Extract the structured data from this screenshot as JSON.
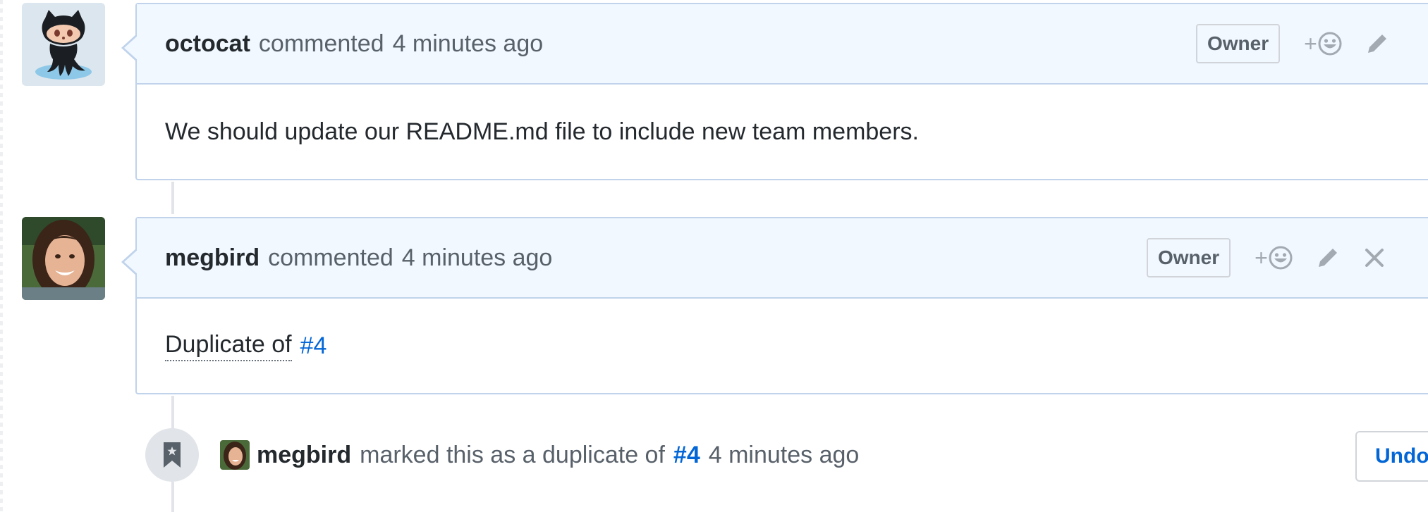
{
  "comments": [
    {
      "author": "octocat",
      "action_text": "commented",
      "time": "4 minutes ago",
      "badge": "Owner",
      "reaction_plus": "+",
      "body": {
        "text": "We should update our README.md file to include new team members."
      }
    },
    {
      "author": "megbird",
      "action_text": "commented",
      "time": "4 minutes ago",
      "badge": "Owner",
      "reaction_plus": "+",
      "body": {
        "prefix": "Duplicate of",
        "issue_ref": "#4"
      }
    }
  ],
  "event": {
    "author": "megbird",
    "text": "marked this as a duplicate of",
    "issue_ref": "#4",
    "time": "4 minutes ago",
    "undo_label": "Undo"
  },
  "colors": {
    "link": "#0366d6",
    "header_bg": "#f1f8ff",
    "border": "#c0d3eb"
  },
  "icons": {
    "reaction": "smiley-icon",
    "edit": "pencil-icon",
    "delete": "close-icon",
    "event": "bookmark-icon"
  }
}
